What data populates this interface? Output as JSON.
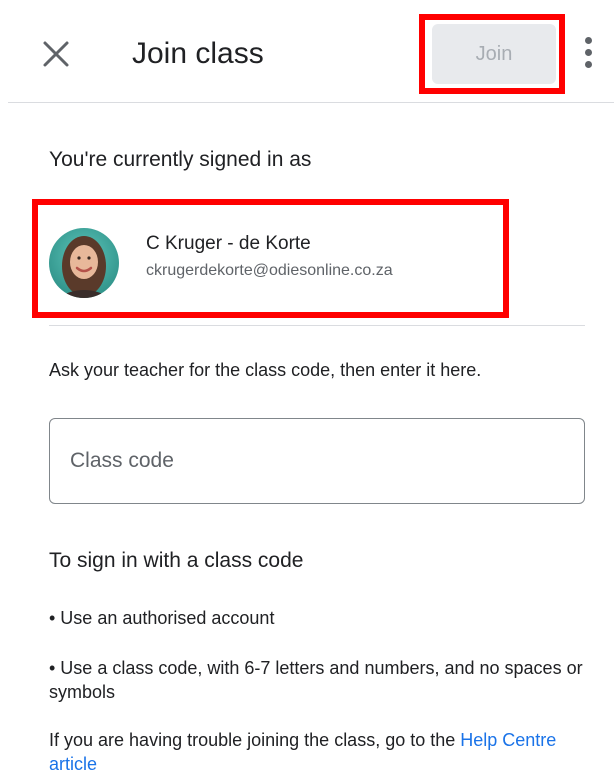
{
  "appbar": {
    "title": "Join class",
    "join_label": "Join",
    "close_icon": "close-icon",
    "more_icon": "more-vert-icon"
  },
  "account": {
    "signed_in_label": "You're currently signed in as",
    "name": "C Kruger - de Korte",
    "email": "ckrugerdekorte@odiesonline.co.za"
  },
  "class_code": {
    "instruction": "Ask your teacher for the class code, then enter it here.",
    "placeholder": "Class code",
    "value": ""
  },
  "help": {
    "heading": "To sign in with a class code",
    "bullets": [
      "• Use an authorised account",
      "• Use a class code, with 6-7 letters and numbers, and no spaces or symbols"
    ],
    "trouble_text": "If you are having trouble joining the class, go to the ",
    "link_text": "Help Centre article"
  },
  "colors": {
    "highlight": "#ff0000",
    "link": "#1a73e8",
    "disabled_button_bg": "#e8eaed",
    "disabled_button_text": "#a8adb3"
  }
}
